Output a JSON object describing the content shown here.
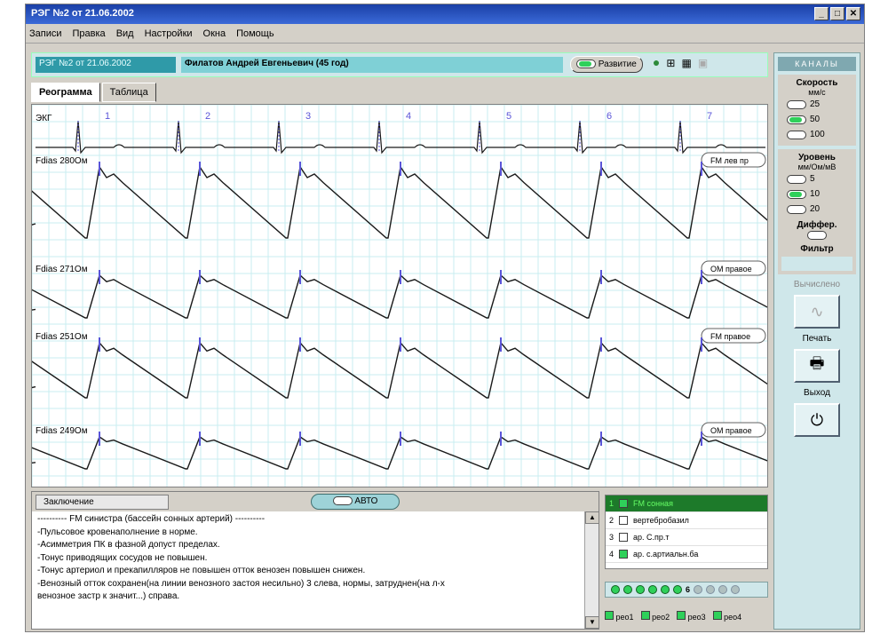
{
  "window": {
    "title": "РЭГ №2 от 21.06.2002"
  },
  "menu": [
    "Записи",
    "Правка",
    "Вид",
    "Настройки",
    "Окна",
    "Помощь"
  ],
  "patient": {
    "record_id": "РЭГ №2 от 21.06.2002",
    "name": "Филатов Андрей Евгеньевич (45 год)",
    "analysis_label": "Развитие"
  },
  "tabs": [
    "Реограмма",
    "Таблица"
  ],
  "ecg": {
    "label": "ЭКГ",
    "beat_numbers": [
      "1",
      "2",
      "3",
      "4",
      "5",
      "6",
      "7"
    ]
  },
  "channels": [
    {
      "label": "Fdias 280Ом",
      "tag": "FM лев пр"
    },
    {
      "label": "Fdias 271Ом",
      "tag": "OM правое"
    },
    {
      "label": "Fdias 251Ом",
      "tag": "FM правое"
    },
    {
      "label": "Fdias 249Ом",
      "tag": "OM правое"
    }
  ],
  "conclusion": {
    "tab_label": "Заключение",
    "auto_label": "АВТО",
    "lines": [
      "---------- FM синистра (бассейн сонных артерий) ----------",
      "-Пульсовое кровенаполнение в норме.",
      "-Асимметрия ПК в фазной допуст пределах.",
      "-Тонус приводящих сосудов не повышен.",
      "-Тонус артериол и прекапилляров не повышен отток венозен повышен снижен.",
      "-Венозный отток сохранен(на линии венозного застоя несильно) 3 слева, нормы, затруднен(нa л-х",
      "венозное застр к значит...) справа."
    ]
  },
  "leads": [
    {
      "num": "1",
      "name": "FM сонная",
      "checked": true,
      "selected": true
    },
    {
      "num": "2",
      "name": "вертебробазил",
      "checked": false,
      "selected": false
    },
    {
      "num": "3",
      "name": "ар. С.пр.т",
      "checked": false,
      "selected": false
    },
    {
      "num": "4",
      "name": "ар. с.артиальн.ба",
      "checked": true,
      "selected": false
    }
  ],
  "leds": {
    "on": 6,
    "off": 4,
    "current": "6"
  },
  "rheo_options": [
    "рео1",
    "рео2",
    "рео3",
    "рео4"
  ],
  "sidebar": {
    "header": "КАНАЛЫ",
    "speed_title": "Скорость",
    "speed_unit": "мм/с",
    "speed_options": [
      "25",
      "50",
      "100"
    ],
    "speed_selected": "50",
    "amp_title": "Уровень",
    "amp_sub": "мм/Ом/мВ",
    "amp_options": [
      "5",
      "10",
      "20"
    ],
    "amp_selected": "10",
    "diff_label": "Диффер.",
    "filter_label": "Фильтр",
    "measure_label": "Вычислено",
    "print_label": "Печать",
    "exit_label": "Выход"
  },
  "colors": {
    "accent": "#2f9aa8",
    "grid": "#c9eef0",
    "trace": "#1a1a1a",
    "marker": "#5a55d8"
  }
}
